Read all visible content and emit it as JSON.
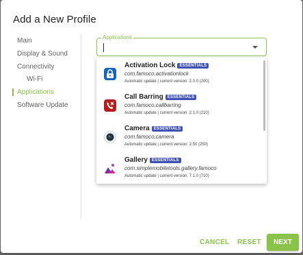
{
  "dialog": {
    "title": "Add a New Profile"
  },
  "nav": {
    "items": [
      {
        "label": "Main",
        "active": false
      },
      {
        "label": "Display & Sound",
        "active": false
      },
      {
        "label": "Connectivity",
        "active": false
      },
      {
        "label": "Wi-Fi",
        "active": false
      },
      {
        "label": "Applications",
        "active": true
      },
      {
        "label": "Software Update",
        "active": false
      }
    ]
  },
  "applications_field": {
    "label": "Applications",
    "value": ""
  },
  "app_list": [
    {
      "name": "Activation Lock",
      "badge": "ESSENTIALS",
      "package": "com.famoco.activationlock",
      "update": "Automatic update | current version: 2.0.0 (200)",
      "icon": "lock-icon"
    },
    {
      "name": "Call Barring",
      "badge": "ESSENTIALS",
      "package": "com.famoco.callbarring",
      "update": "Automatic update | current version: 2.1.0 (210)",
      "icon": "phone-icon"
    },
    {
      "name": "Camera",
      "badge": "ESSENTIALS",
      "package": "com.famoco.camera",
      "update": "Automatic update | current version: 2.50 (250)",
      "icon": "camera-icon"
    },
    {
      "name": "Gallery",
      "badge": "ESSENTIALS",
      "package": "com.simplemobiletools.gallery.famoco",
      "update": "Automatic update | current version: 7.1.0 (710)",
      "icon": "gallery-icon"
    }
  ],
  "footer": {
    "cancel": "CANCEL",
    "reset": "RESET",
    "next": "NEXT"
  },
  "colors": {
    "accent": "#8bc34a",
    "badge": "#3f51b5"
  }
}
